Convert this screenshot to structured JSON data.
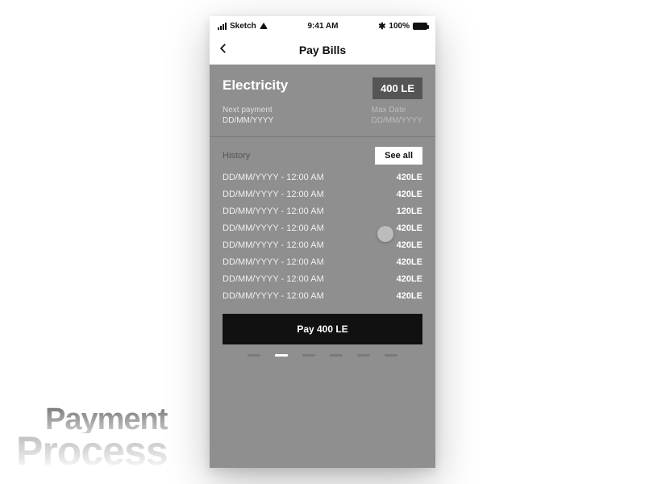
{
  "statusbar": {
    "carrier": "Sketch",
    "time": "9:41 AM",
    "battery": "100%"
  },
  "nav": {
    "title": "Pay Bills"
  },
  "bill": {
    "name": "Electricity",
    "amount": "400 LE",
    "next_label": "Next payment",
    "next_value": "DD/MM/YYYY",
    "max_label": "Max Date",
    "max_value": "DD/MM/YYYY"
  },
  "history": {
    "label": "History",
    "see_all": "See all",
    "rows": [
      {
        "date": "DD/MM/YYYY - 12:00 AM",
        "amount": "420LE"
      },
      {
        "date": "DD/MM/YYYY - 12:00 AM",
        "amount": "420LE"
      },
      {
        "date": "DD/MM/YYYY - 12:00 AM",
        "amount": "120LE"
      },
      {
        "date": "DD/MM/YYYY - 12:00 AM",
        "amount": "420LE"
      },
      {
        "date": "DD/MM/YYYY - 12:00 AM",
        "amount": "420LE"
      },
      {
        "date": "DD/MM/YYYY - 12:00 AM",
        "amount": "420LE"
      },
      {
        "date": "DD/MM/YYYY - 12:00 AM",
        "amount": "420LE"
      },
      {
        "date": "DD/MM/YYYY - 12:00 AM",
        "amount": "420LE"
      }
    ]
  },
  "pay_button": "Pay 400 LE",
  "pager": {
    "count": 6,
    "active": 1
  },
  "watermark": {
    "line1": "Payment",
    "line2": "Process"
  }
}
